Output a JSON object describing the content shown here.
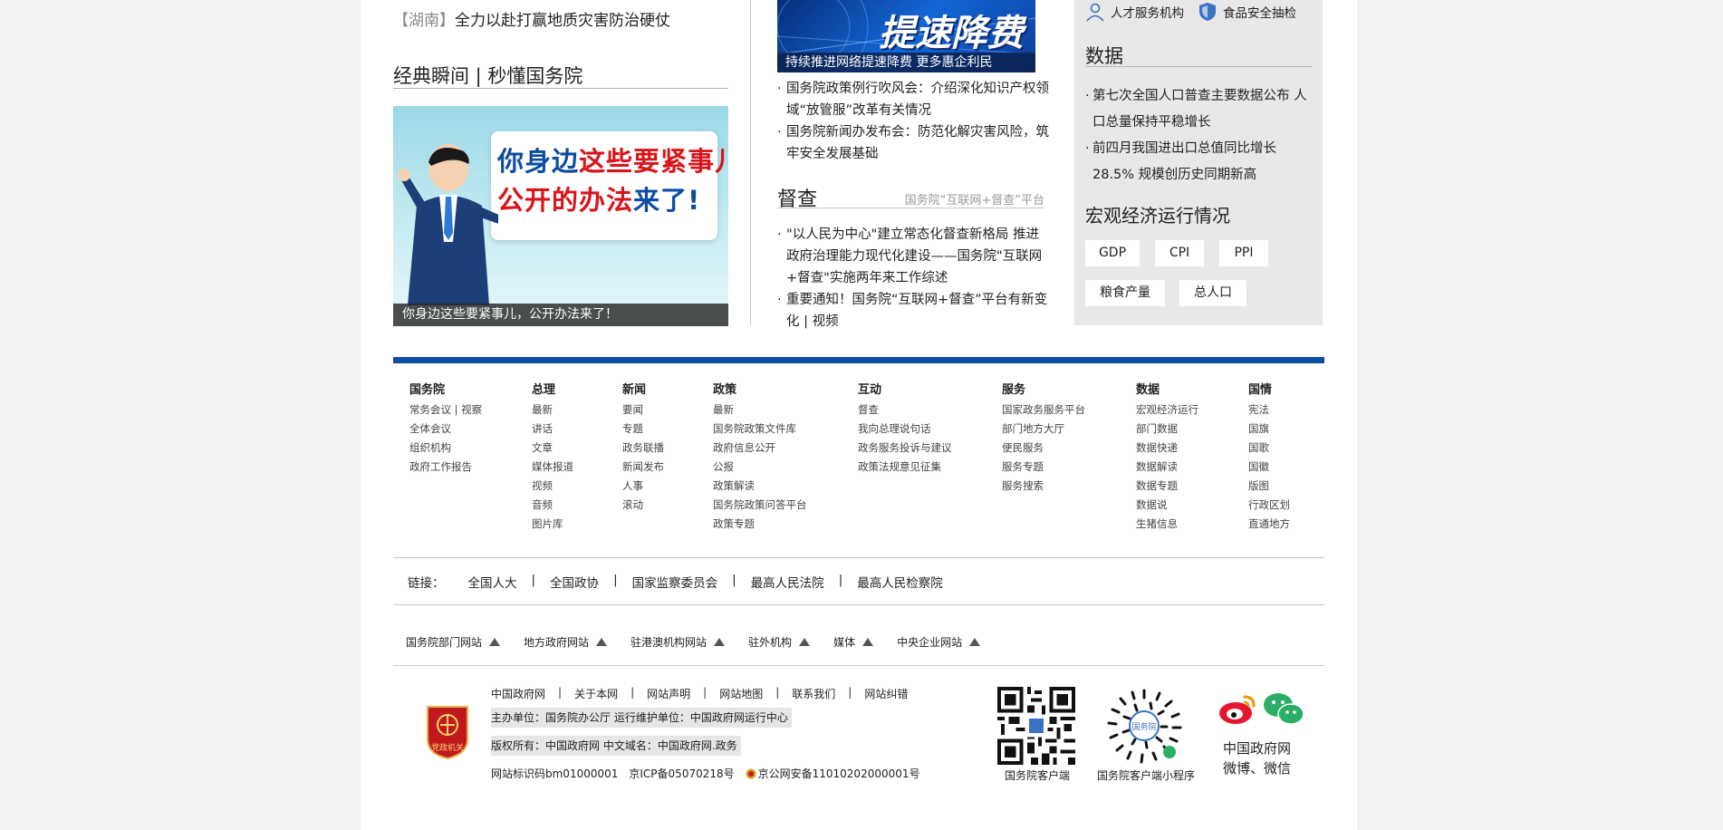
{
  "left": {
    "hunan_tag": "【湖南】",
    "hunan_text": "全力以赴打赢地质灾害防治硬仗",
    "classic_title": "经典瞬间 | 秒懂国务院",
    "banner_line1_part1": "你身边",
    "banner_line1_part2": "这些要紧事儿",
    "banner_line2_part1": "公开的办法",
    "banner_line2_part2": "来了!",
    "banner_caption": "你身边这些要紧事儿，公开办法来了！"
  },
  "middle": {
    "promo_big": "提速降费",
    "promo_caption": "持续推进网络提速降费 更多惠企利民",
    "news": [
      "国务院政策例行吹风会：介绍深化知识产权领域“放管服”改革有关情况",
      "国务院新闻办发布会：防范化解灾害风险，筑牢安全发展基础"
    ],
    "supervise_title": "督查",
    "supervise_sub": "国务院“互联网+督查”平台",
    "supervise_news": [
      "\"以人民为中心\"建立常态化督查新格局 推进政府治理能力现代化建设——国务院\"互联网+督查\"实施两年来工作综述",
      "重要通知！国务院“互联网+督查”平台有新变化 | 视频"
    ]
  },
  "right": {
    "service1": "人才服务机构",
    "service2": "食品安全抽检",
    "data_title": "数据",
    "data_news": [
      "第七次全国人口普查主要数据公布 人口总量保持平稳增长",
      "前四月我国进出口总值同比增长 28.5% 规模创历史同期新高"
    ],
    "macro_title": "宏观经济运行情况",
    "macro_buttons": [
      "GDP",
      "CPI",
      "PPI",
      "粮食产量",
      "总人口"
    ]
  },
  "footer": {
    "columns": [
      {
        "title": "国务院",
        "items": [
          "常务会议 | 视察",
          "全体会议",
          "组织机构",
          "政府工作报告"
        ]
      },
      {
        "title": "总理",
        "items": [
          "最新",
          "讲话",
          "文章",
          "媒体报道",
          "视频",
          "音频",
          "图片库"
        ]
      },
      {
        "title": "新闻",
        "items": [
          "要闻",
          "专题",
          "政务联播",
          "新闻发布",
          "人事",
          "滚动"
        ]
      },
      {
        "title": "政策",
        "items": [
          "最新",
          "国务院政策文件库",
          "政府信息公开",
          "公报",
          "政策解读",
          "国务院政策问答平台",
          "政策专题"
        ]
      },
      {
        "title": "互动",
        "items": [
          "督查",
          "我向总理说句话",
          "政务服务投诉与建议",
          "政策法规意见征集"
        ]
      },
      {
        "title": "服务",
        "items": [
          "国家政务服务平台",
          "部门地方大厅",
          "便民服务",
          "服务专题",
          "服务搜索"
        ]
      },
      {
        "title": "数据",
        "items": [
          "宏观经济运行",
          "部门数据",
          "数据快递",
          "数据解读",
          "数据专题",
          "数据说",
          "生猪信息"
        ]
      },
      {
        "title": "国情",
        "items": [
          "宪法",
          "国旗",
          "国歌",
          "国徽",
          "版图",
          "行政区划",
          "直通地方"
        ]
      }
    ],
    "links_label": "链接：",
    "links": [
      "全国人大",
      "全国政协",
      "国家监察委员会",
      "最高人民法院",
      "最高人民检察院"
    ],
    "sites": [
      "国务院部门网站",
      "地方政府网站",
      "驻港澳机构网站",
      "驻外机构",
      "媒体",
      "中央企业网站"
    ],
    "bottom_links": [
      "中国政府网",
      "关于本网",
      "网站声明",
      "网站地图",
      "联系我们",
      "网站纠错"
    ],
    "sponsor": "主办单位：国务院办公厅   运行维护单位：中国政府网运行中心",
    "copyright": "版权所有：中国政府网   中文域名：中国政府网.政务",
    "icp_id": "网站标识码bm01000001",
    "icp": "京ICP备05070218号",
    "police": "京公网安备11010202000001号",
    "emblem_text": "党政机关",
    "qr1_label": "国务院客户端",
    "qr2_label": "国务院客户端小程序",
    "qr2_center": "国务院",
    "weibo_line1": "中国政府网",
    "weibo_line2": "微博、微信"
  }
}
